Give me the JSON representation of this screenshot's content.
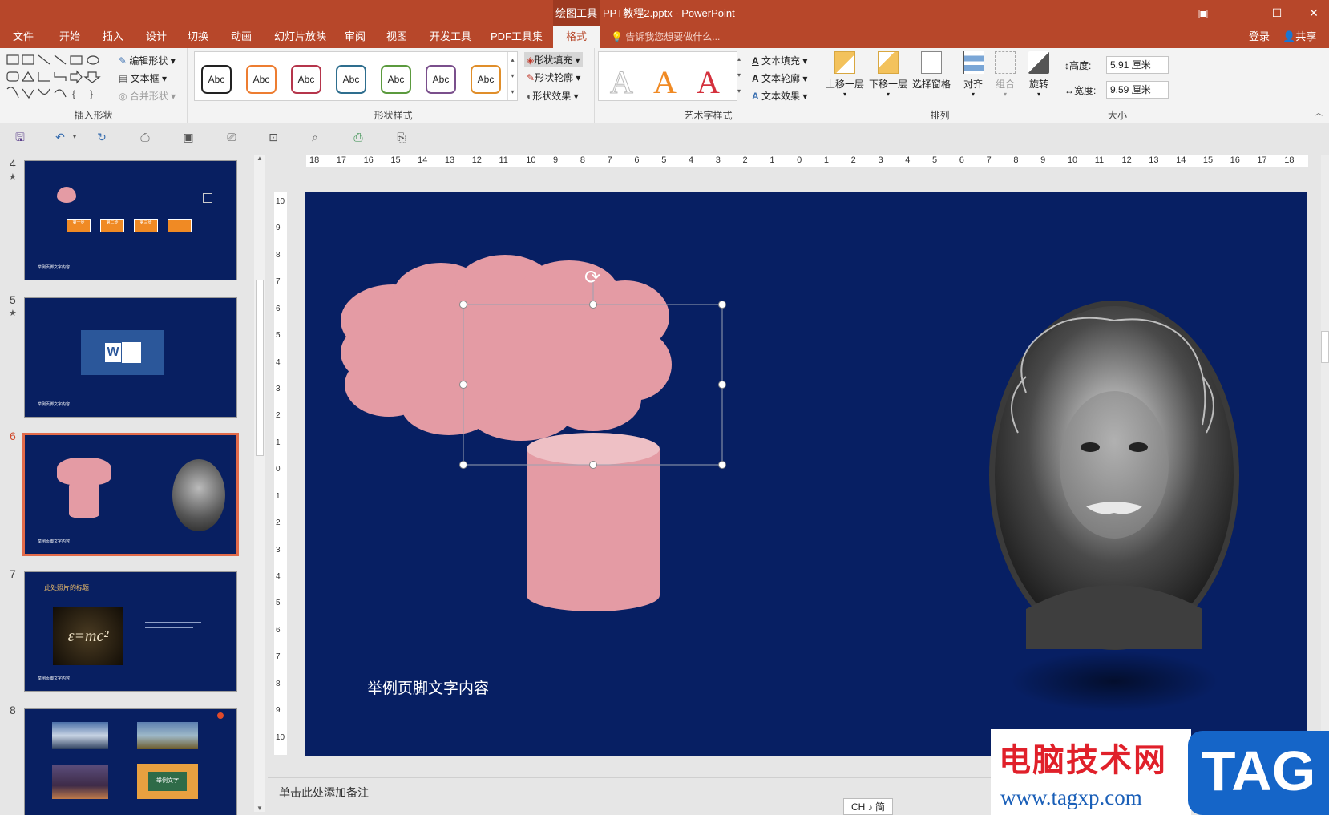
{
  "titlebar": {
    "context_tab": "绘图工具",
    "doc_title": "PPT教程2.pptx - PowerPoint",
    "btn_restore_ribbon": "▣",
    "btn_min": "—",
    "btn_max": "☐",
    "btn_close": "✕"
  },
  "menu": {
    "tabs": [
      "文件",
      "开始",
      "插入",
      "设计",
      "切换",
      "动画",
      "幻灯片放映",
      "审阅",
      "视图",
      "开发工具",
      "PDF工具集",
      "格式"
    ],
    "active": "格式",
    "tellme": "告诉我您想要做什么...",
    "login": "登录",
    "share": "共享"
  },
  "ribbon": {
    "insert_shapes": {
      "label": "插入形状",
      "edit_shape": "编辑形状",
      "text_box": "文本框",
      "merge_shapes": "合并形状"
    },
    "shape_styles": {
      "label": "形状样式",
      "samples": [
        "Abc",
        "Abc",
        "Abc",
        "Abc",
        "Abc",
        "Abc",
        "Abc"
      ],
      "sample_colors": [
        "#222222",
        "#ed7d31",
        "#b5354b",
        "#2e6e8e",
        "#5b9a3e",
        "#7a4f8c",
        "#e08e2a"
      ],
      "fill": "形状填充",
      "outline": "形状轮廓",
      "effects": "形状效果"
    },
    "wordart": {
      "label": "艺术字样式",
      "samples": [
        "A",
        "A",
        "A"
      ],
      "text_fill": "文本填充",
      "text_outline": "文本轮廓",
      "text_effects": "文本效果"
    },
    "arrange": {
      "label": "排列",
      "bring_forward": "上移一层",
      "send_backward": "下移一层",
      "selection_pane": "选择窗格",
      "align": "对齐",
      "group": "组合",
      "rotate": "旋转"
    },
    "size": {
      "label": "大小",
      "height_label": "高度:",
      "height_value": "5.91 厘米",
      "width_label": "宽度:",
      "width_value": "9.59 厘米"
    }
  },
  "thumbnails": [
    {
      "num": "4",
      "star": "★",
      "footer": "举例页脚文字内容"
    },
    {
      "num": "5",
      "star": "★",
      "footer": "举例页脚文字内容"
    },
    {
      "num": "6",
      "star": "",
      "footer": "举例页脚文字内容"
    },
    {
      "num": "7",
      "star": "",
      "footer": "举例页脚文字内容",
      "title": "此处照片的标题"
    },
    {
      "num": "8",
      "star": "",
      "footer": "",
      "caption": "举例文字"
    }
  ],
  "thumb4_steps": [
    "第一步",
    "第二步",
    "第三步",
    ""
  ],
  "ruler": {
    "h": [
      "18",
      "17",
      "16",
      "15",
      "14",
      "13",
      "12",
      "11",
      "10",
      "9",
      "8",
      "7",
      "6",
      "5",
      "4",
      "3",
      "2",
      "1",
      "0",
      "1",
      "2",
      "3",
      "4",
      "5",
      "6",
      "7",
      "8",
      "9",
      "10",
      "11",
      "12",
      "13",
      "14",
      "15",
      "16",
      "17",
      "18"
    ],
    "v": [
      "10",
      "9",
      "8",
      "7",
      "6",
      "5",
      "4",
      "3",
      "2",
      "1",
      "0",
      "1",
      "2",
      "3",
      "4",
      "5",
      "6",
      "7",
      "8",
      "9",
      "10"
    ]
  },
  "slide": {
    "footer_text": "举例页脚文字内容",
    "shape_color": "#e49ba4",
    "background": "#071f63"
  },
  "notes": {
    "placeholder": "单击此处添加备注"
  },
  "ime": "CH ♪ 简",
  "watermark": {
    "cn": "电脑技术网",
    "url": "www.tagxp.com",
    "tag": "TAG"
  }
}
